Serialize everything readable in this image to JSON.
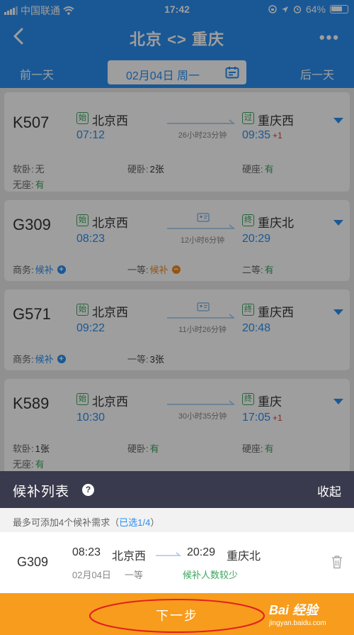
{
  "status_bar": {
    "carrier": "中国联通",
    "time": "17:42",
    "battery": "64%"
  },
  "nav": {
    "title": "北京 <> 重庆"
  },
  "date_bar": {
    "prev": "前一天",
    "date": "02月04日 周一",
    "next": "后一天"
  },
  "trains": [
    {
      "no": "K507",
      "dep_badge": "始",
      "dep_station": "北京西",
      "dep_time": "07:12",
      "duration": "26小时23分钟",
      "arr_badge": "过",
      "arr_station": "重庆西",
      "arr_time": "09:35",
      "plus": "+1",
      "seats": [
        {
          "label": "软卧:",
          "value": "无"
        },
        {
          "label": "硬卧:",
          "value": "2张"
        },
        {
          "label": "硬座:",
          "value": "有"
        },
        {
          "label": "无座:",
          "value": "有"
        }
      ]
    },
    {
      "no": "G309",
      "dep_badge": "始",
      "dep_station": "北京西",
      "dep_time": "08:23",
      "duration": "12小时6分钟",
      "arr_badge": "终",
      "arr_station": "重庆北",
      "arr_time": "20:29",
      "plus": "",
      "seats": [
        {
          "label": "商务:",
          "value": "候补"
        },
        {
          "label": "一等:",
          "value": "候补"
        },
        {
          "label": "二等:",
          "value": "有"
        }
      ]
    },
    {
      "no": "G571",
      "dep_badge": "始",
      "dep_station": "北京西",
      "dep_time": "09:22",
      "duration": "11小时26分钟",
      "arr_badge": "终",
      "arr_station": "重庆西",
      "arr_time": "20:48",
      "plus": "",
      "seats": [
        {
          "label": "商务:",
          "value": "候补"
        },
        {
          "label": "一等:",
          "value": "3张"
        }
      ]
    },
    {
      "no": "K589",
      "dep_badge": "始",
      "dep_station": "北京西",
      "dep_time": "10:30",
      "duration": "30小时35分钟",
      "arr_badge": "终",
      "arr_station": "重庆",
      "arr_time": "17:05",
      "plus": "+1",
      "seats": [
        {
          "label": "软卧:",
          "value": "1张"
        },
        {
          "label": "硬卧:",
          "value": "有"
        },
        {
          "label": "硬座:",
          "value": "有"
        },
        {
          "label": "无座:",
          "value": "有"
        }
      ]
    }
  ],
  "waitlist": {
    "title": "候补列表",
    "collapse": "收起",
    "hint": "最多可添加4个候补需求（",
    "hint_selected": "已选1/4",
    "hint_end": "）",
    "item": {
      "no": "G309",
      "dep_time": "08:23",
      "dep_station": "北京西",
      "arr_time": "20:29",
      "arr_station": "重庆北",
      "date": "02月04日",
      "class": "一等",
      "status": "候补人数较少"
    }
  },
  "next_button": "下一步",
  "watermark": {
    "logo": "Bai 经验",
    "url": "jingyan.baidu.com"
  },
  "colors": {
    "primary": "#2a8ef0",
    "available": "#3aa55c",
    "waitlist_orange": "#f08a24",
    "next_bar": "#f79c1c",
    "panel": "#3a3a4e"
  }
}
